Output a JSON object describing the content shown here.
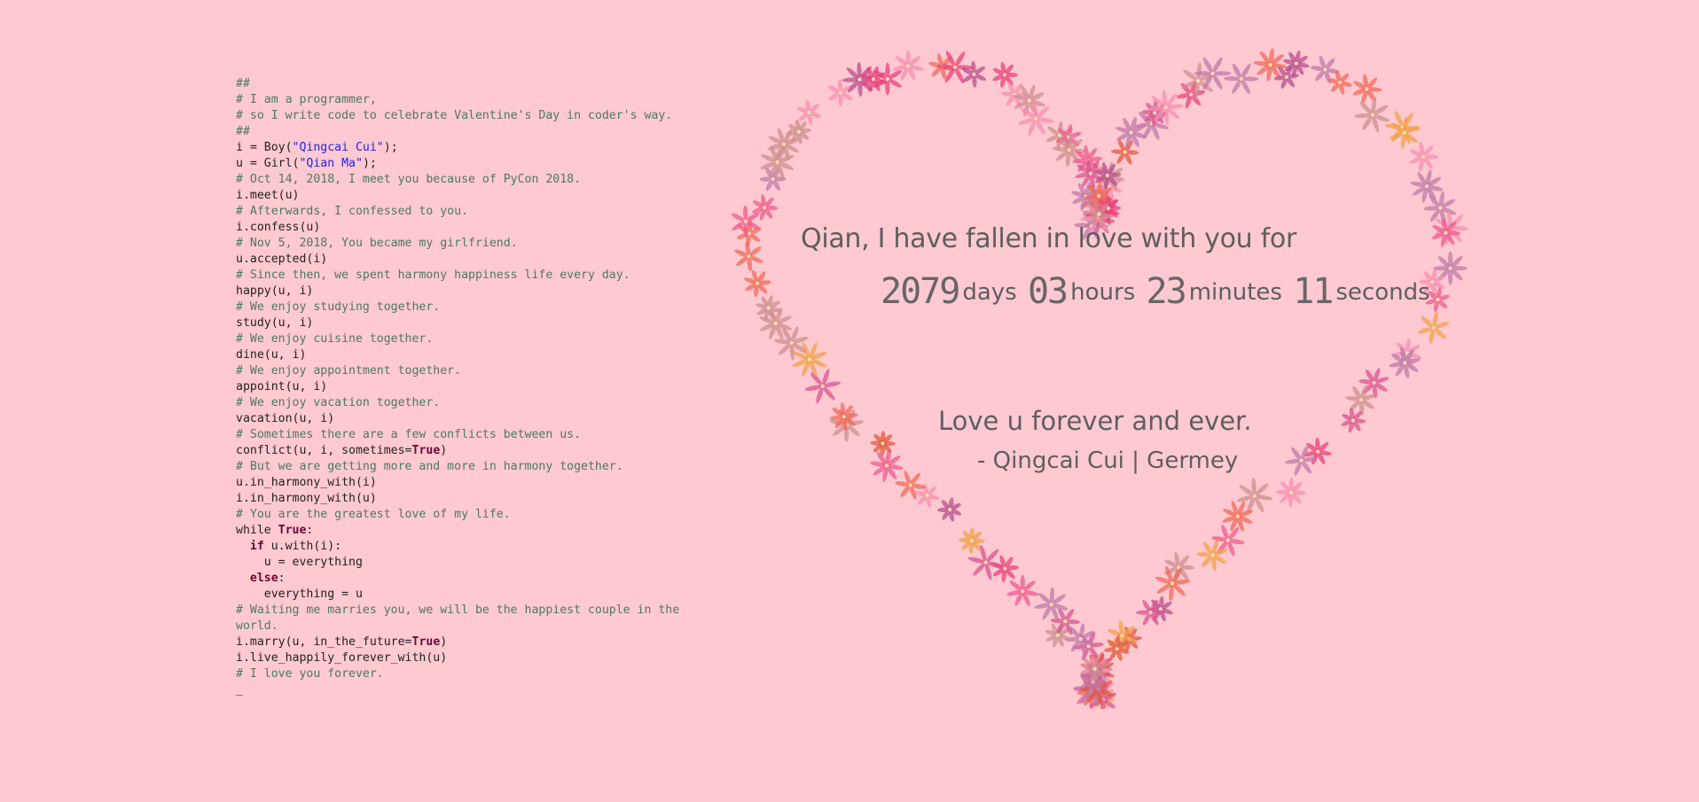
{
  "code_lines": [
    {
      "parts": [
        {
          "t": "##",
          "c": "comment"
        }
      ]
    },
    {
      "parts": [
        {
          "t": "# I am a programmer,",
          "c": "comment"
        }
      ]
    },
    {
      "parts": [
        {
          "t": "# so I write code to celebrate Valentine's Day in coder's way.",
          "c": "comment"
        }
      ]
    },
    {
      "parts": [
        {
          "t": "##",
          "c": "comment"
        }
      ]
    },
    {
      "parts": [
        {
          "t": "i = Boy(",
          "c": ""
        },
        {
          "t": "\"Qingcai Cui\"",
          "c": "str"
        },
        {
          "t": ");",
          "c": ""
        }
      ]
    },
    {
      "parts": [
        {
          "t": "u = Girl(",
          "c": ""
        },
        {
          "t": "\"Qian Ma\"",
          "c": "str"
        },
        {
          "t": ");",
          "c": ""
        }
      ]
    },
    {
      "parts": [
        {
          "t": "# Oct 14, 2018, I meet you because of PyCon 2018.",
          "c": "comment"
        }
      ]
    },
    {
      "parts": [
        {
          "t": "i.meet(u)",
          "c": ""
        }
      ]
    },
    {
      "parts": [
        {
          "t": "# Afterwards, I confessed to you.",
          "c": "comment"
        }
      ]
    },
    {
      "parts": [
        {
          "t": "i.confess(u)",
          "c": ""
        }
      ]
    },
    {
      "parts": [
        {
          "t": "# Nov 5, 2018, You became my girlfriend.",
          "c": "comment"
        }
      ]
    },
    {
      "parts": [
        {
          "t": "u.accepted(i)",
          "c": ""
        }
      ]
    },
    {
      "parts": [
        {
          "t": "# Since then, we spent harmony happiness life every day.",
          "c": "comment"
        }
      ]
    },
    {
      "parts": [
        {
          "t": "happy(u, i)",
          "c": ""
        }
      ]
    },
    {
      "parts": [
        {
          "t": "# We enjoy studying together.",
          "c": "comment"
        }
      ]
    },
    {
      "parts": [
        {
          "t": "study(u, i)",
          "c": ""
        }
      ]
    },
    {
      "parts": [
        {
          "t": "# We enjoy cuisine together.",
          "c": "comment"
        }
      ]
    },
    {
      "parts": [
        {
          "t": "dine(u, i)",
          "c": ""
        }
      ]
    },
    {
      "parts": [
        {
          "t": "# We enjoy appointment together.",
          "c": "comment"
        }
      ]
    },
    {
      "parts": [
        {
          "t": "appoint(u, i)",
          "c": ""
        }
      ]
    },
    {
      "parts": [
        {
          "t": "# We enjoy vacation together.",
          "c": "comment"
        }
      ]
    },
    {
      "parts": [
        {
          "t": "vacation(u, i)",
          "c": ""
        }
      ]
    },
    {
      "parts": [
        {
          "t": "# Sometimes there are a few conflicts between us.",
          "c": "comment"
        }
      ]
    },
    {
      "parts": [
        {
          "t": "conflict(u, i, sometimes=",
          "c": ""
        },
        {
          "t": "True",
          "c": "kw"
        },
        {
          "t": ")",
          "c": ""
        }
      ]
    },
    {
      "parts": [
        {
          "t": "# But we are getting more and more in harmony together.",
          "c": "comment"
        }
      ]
    },
    {
      "parts": [
        {
          "t": "u.in_harmony_with(i)",
          "c": ""
        }
      ]
    },
    {
      "parts": [
        {
          "t": "i.in_harmony_with(u)",
          "c": ""
        }
      ]
    },
    {
      "parts": [
        {
          "t": "# You are the greatest love of my life.",
          "c": "comment"
        }
      ]
    },
    {
      "parts": [
        {
          "t": "while ",
          "c": ""
        },
        {
          "t": "True",
          "c": "kw"
        },
        {
          "t": ":",
          "c": ""
        }
      ]
    },
    {
      "parts": [
        {
          "t": "  ",
          "c": ""
        },
        {
          "t": "if",
          "c": "kw"
        },
        {
          "t": " u.with(i):",
          "c": ""
        }
      ]
    },
    {
      "parts": [
        {
          "t": "    u = everything",
          "c": ""
        }
      ]
    },
    {
      "parts": [
        {
          "t": "  ",
          "c": ""
        },
        {
          "t": "else",
          "c": "kw"
        },
        {
          "t": ":",
          "c": ""
        }
      ]
    },
    {
      "parts": [
        {
          "t": "    everything = u",
          "c": ""
        }
      ]
    },
    {
      "parts": [
        {
          "t": "# Waiting me marries you, we will be the happiest couple in the world.",
          "c": "comment"
        }
      ]
    },
    {
      "parts": [
        {
          "t": "i.marry(u, in_the_future=",
          "c": ""
        },
        {
          "t": "True",
          "c": "kw"
        },
        {
          "t": ")",
          "c": ""
        }
      ]
    },
    {
      "parts": [
        {
          "t": "i.live_happily_forever_with(u)",
          "c": ""
        }
      ]
    },
    {
      "parts": [
        {
          "t": "# I love you forever.",
          "c": "comment"
        }
      ]
    },
    {
      "parts": [
        {
          "t": "_",
          "c": "cursor"
        }
      ]
    }
  ],
  "message": {
    "line1": "Qian, I have fallen in love with you for",
    "days_value": "2079",
    "days_label": "days",
    "hours_value": "03",
    "hours_label": "hours",
    "minutes_value": "23",
    "minutes_label": "minutes",
    "seconds_value": "11",
    "seconds_label": "seconds",
    "line3": "Love u forever and ever.",
    "line4": "- Qingcai Cui | Germey"
  },
  "colors": {
    "background": "#ffc9d1",
    "text": "#5e5e5e",
    "comment": "#4b7a5e",
    "string": "#2424e6",
    "keyword": "#6b0838",
    "flower_palette": [
      "#e8417a",
      "#f06a5a",
      "#d9548f",
      "#f2a04a",
      "#c07aa8",
      "#ee5b8d",
      "#e05a3d",
      "#cf8f8f",
      "#b84f8c",
      "#f58fb0"
    ]
  },
  "icons": {
    "heart": "heart-of-flowers"
  }
}
